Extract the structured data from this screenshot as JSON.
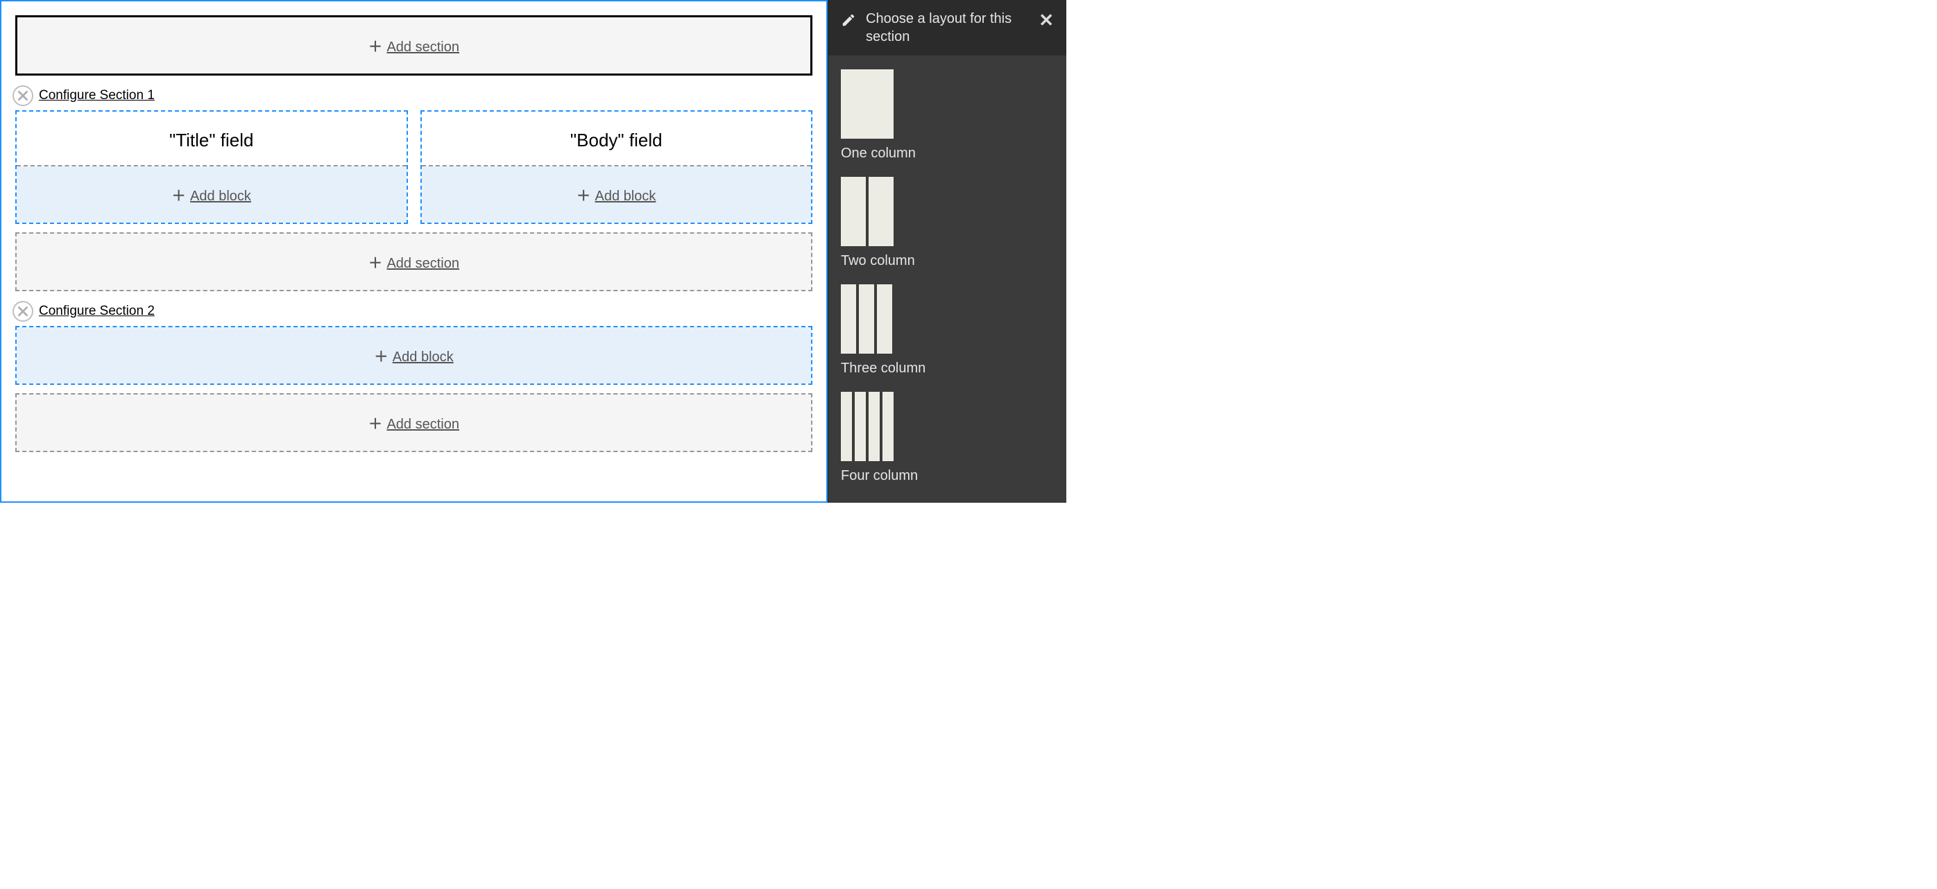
{
  "main": {
    "add_section_top": "Add section",
    "sections": [
      {
        "remove_label": "Remove",
        "configure_label": "Configure Section 1",
        "columns": [
          {
            "block_label": "\"Title\" field",
            "add_block": "Add block"
          },
          {
            "block_label": "\"Body\" field",
            "add_block": "Add block"
          }
        ],
        "add_section_after": "Add section"
      },
      {
        "remove_label": "Remove",
        "configure_label": "Configure Section 2",
        "columns": [
          {
            "add_block": "Add block"
          }
        ],
        "add_section_after": "Add section"
      }
    ]
  },
  "sidebar": {
    "title": "Choose a layout for this section",
    "close_label": "Close",
    "options": [
      {
        "id": "one",
        "label": "One column",
        "cols": 1
      },
      {
        "id": "two",
        "label": "Two column",
        "cols": 2
      },
      {
        "id": "three",
        "label": "Three column",
        "cols": 3
      },
      {
        "id": "four",
        "label": "Four column",
        "cols": 4
      }
    ]
  }
}
